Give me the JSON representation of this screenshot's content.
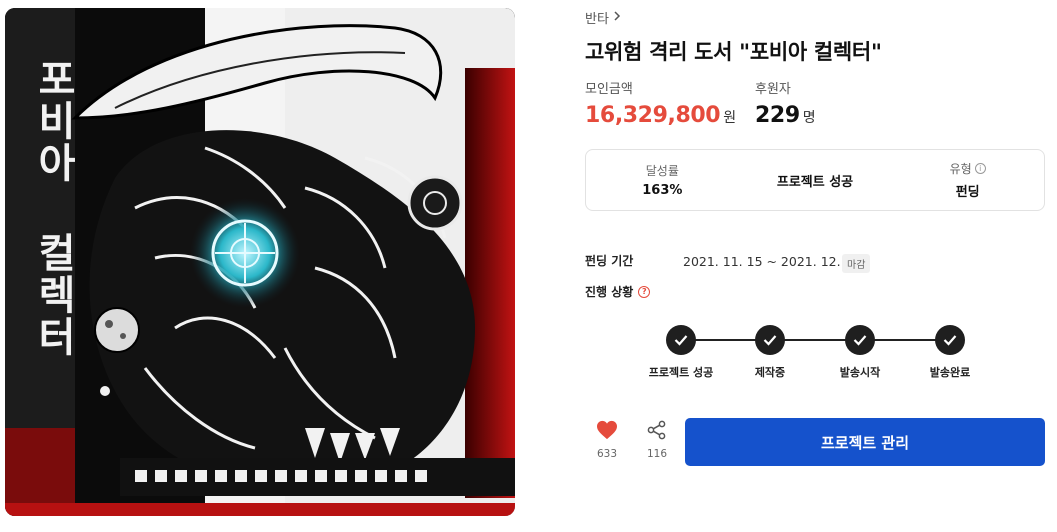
{
  "cover": {
    "vertical_title": "포비아 컬렉터"
  },
  "breadcrumb": {
    "label": "반타"
  },
  "project": {
    "title": "고위험 격리 도서 \"포비아 컬렉터\""
  },
  "stats": {
    "amount_label": "모인금액",
    "amount_value": "16,329,800",
    "amount_unit": "원",
    "backers_label": "후원자",
    "backers_value": "229",
    "backers_unit": "명"
  },
  "status": {
    "rate_label": "달성률",
    "rate_value": "163%",
    "result": "프로젝트 성공",
    "type_label": "유형",
    "type_value": "펀딩"
  },
  "period": {
    "label": "펀딩 기간",
    "value": "2021. 11. 15 ~ 2021. 12. 15",
    "badge": "마감"
  },
  "progress": {
    "label": "진행 상황",
    "steps": [
      {
        "label": "프로젝트 성공",
        "done": true
      },
      {
        "label": "제작중",
        "done": true
      },
      {
        "label": "발송시작",
        "done": true
      },
      {
        "label": "발송완료",
        "done": true
      }
    ]
  },
  "actions": {
    "like_count": "633",
    "share_count": "116",
    "manage_label": "프로젝트 관리"
  },
  "colors": {
    "accent_red": "#e54b3c",
    "primary_blue": "#1552cc",
    "step_dark": "#1f1f1f"
  }
}
